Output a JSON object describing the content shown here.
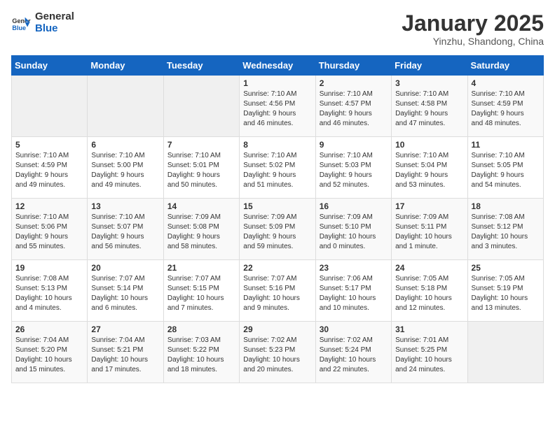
{
  "header": {
    "logo_general": "General",
    "logo_blue": "Blue",
    "month_title": "January 2025",
    "location": "Yinzhu, Shandong, China"
  },
  "days_of_week": [
    "Sunday",
    "Monday",
    "Tuesday",
    "Wednesday",
    "Thursday",
    "Friday",
    "Saturday"
  ],
  "weeks": [
    [
      {
        "day": "",
        "info": ""
      },
      {
        "day": "",
        "info": ""
      },
      {
        "day": "",
        "info": ""
      },
      {
        "day": "1",
        "info": "Sunrise: 7:10 AM\nSunset: 4:56 PM\nDaylight: 9 hours\nand 46 minutes."
      },
      {
        "day": "2",
        "info": "Sunrise: 7:10 AM\nSunset: 4:57 PM\nDaylight: 9 hours\nand 46 minutes."
      },
      {
        "day": "3",
        "info": "Sunrise: 7:10 AM\nSunset: 4:58 PM\nDaylight: 9 hours\nand 47 minutes."
      },
      {
        "day": "4",
        "info": "Sunrise: 7:10 AM\nSunset: 4:59 PM\nDaylight: 9 hours\nand 48 minutes."
      }
    ],
    [
      {
        "day": "5",
        "info": "Sunrise: 7:10 AM\nSunset: 4:59 PM\nDaylight: 9 hours\nand 49 minutes."
      },
      {
        "day": "6",
        "info": "Sunrise: 7:10 AM\nSunset: 5:00 PM\nDaylight: 9 hours\nand 49 minutes."
      },
      {
        "day": "7",
        "info": "Sunrise: 7:10 AM\nSunset: 5:01 PM\nDaylight: 9 hours\nand 50 minutes."
      },
      {
        "day": "8",
        "info": "Sunrise: 7:10 AM\nSunset: 5:02 PM\nDaylight: 9 hours\nand 51 minutes."
      },
      {
        "day": "9",
        "info": "Sunrise: 7:10 AM\nSunset: 5:03 PM\nDaylight: 9 hours\nand 52 minutes."
      },
      {
        "day": "10",
        "info": "Sunrise: 7:10 AM\nSunset: 5:04 PM\nDaylight: 9 hours\nand 53 minutes."
      },
      {
        "day": "11",
        "info": "Sunrise: 7:10 AM\nSunset: 5:05 PM\nDaylight: 9 hours\nand 54 minutes."
      }
    ],
    [
      {
        "day": "12",
        "info": "Sunrise: 7:10 AM\nSunset: 5:06 PM\nDaylight: 9 hours\nand 55 minutes."
      },
      {
        "day": "13",
        "info": "Sunrise: 7:10 AM\nSunset: 5:07 PM\nDaylight: 9 hours\nand 56 minutes."
      },
      {
        "day": "14",
        "info": "Sunrise: 7:09 AM\nSunset: 5:08 PM\nDaylight: 9 hours\nand 58 minutes."
      },
      {
        "day": "15",
        "info": "Sunrise: 7:09 AM\nSunset: 5:09 PM\nDaylight: 9 hours\nand 59 minutes."
      },
      {
        "day": "16",
        "info": "Sunrise: 7:09 AM\nSunset: 5:10 PM\nDaylight: 10 hours\nand 0 minutes."
      },
      {
        "day": "17",
        "info": "Sunrise: 7:09 AM\nSunset: 5:11 PM\nDaylight: 10 hours\nand 1 minute."
      },
      {
        "day": "18",
        "info": "Sunrise: 7:08 AM\nSunset: 5:12 PM\nDaylight: 10 hours\nand 3 minutes."
      }
    ],
    [
      {
        "day": "19",
        "info": "Sunrise: 7:08 AM\nSunset: 5:13 PM\nDaylight: 10 hours\nand 4 minutes."
      },
      {
        "day": "20",
        "info": "Sunrise: 7:07 AM\nSunset: 5:14 PM\nDaylight: 10 hours\nand 6 minutes."
      },
      {
        "day": "21",
        "info": "Sunrise: 7:07 AM\nSunset: 5:15 PM\nDaylight: 10 hours\nand 7 minutes."
      },
      {
        "day": "22",
        "info": "Sunrise: 7:07 AM\nSunset: 5:16 PM\nDaylight: 10 hours\nand 9 minutes."
      },
      {
        "day": "23",
        "info": "Sunrise: 7:06 AM\nSunset: 5:17 PM\nDaylight: 10 hours\nand 10 minutes."
      },
      {
        "day": "24",
        "info": "Sunrise: 7:05 AM\nSunset: 5:18 PM\nDaylight: 10 hours\nand 12 minutes."
      },
      {
        "day": "25",
        "info": "Sunrise: 7:05 AM\nSunset: 5:19 PM\nDaylight: 10 hours\nand 13 minutes."
      }
    ],
    [
      {
        "day": "26",
        "info": "Sunrise: 7:04 AM\nSunset: 5:20 PM\nDaylight: 10 hours\nand 15 minutes."
      },
      {
        "day": "27",
        "info": "Sunrise: 7:04 AM\nSunset: 5:21 PM\nDaylight: 10 hours\nand 17 minutes."
      },
      {
        "day": "28",
        "info": "Sunrise: 7:03 AM\nSunset: 5:22 PM\nDaylight: 10 hours\nand 18 minutes."
      },
      {
        "day": "29",
        "info": "Sunrise: 7:02 AM\nSunset: 5:23 PM\nDaylight: 10 hours\nand 20 minutes."
      },
      {
        "day": "30",
        "info": "Sunrise: 7:02 AM\nSunset: 5:24 PM\nDaylight: 10 hours\nand 22 minutes."
      },
      {
        "day": "31",
        "info": "Sunrise: 7:01 AM\nSunset: 5:25 PM\nDaylight: 10 hours\nand 24 minutes."
      },
      {
        "day": "",
        "info": ""
      }
    ]
  ]
}
